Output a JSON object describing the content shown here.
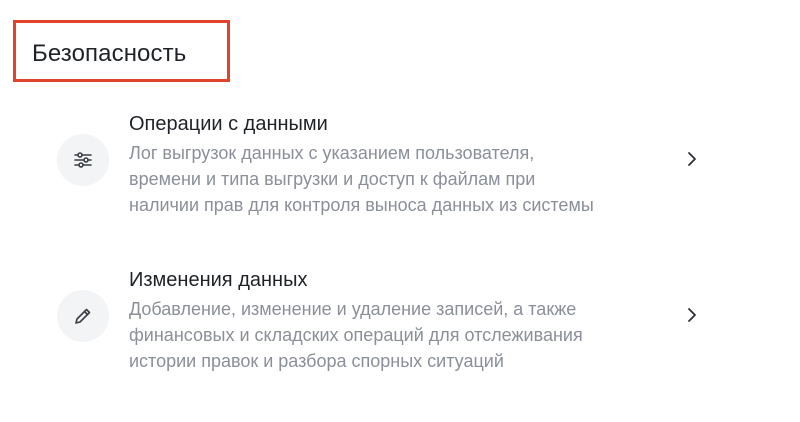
{
  "section": {
    "title": "Безопасность",
    "highlight_color": "#e0442b"
  },
  "items": [
    {
      "icon": "sliders-icon",
      "title": "Операции с данными",
      "description_lines": [
        "Лог выгрузок данных с указанием пользователя,",
        "времени и типа выгрузки и доступ к файлам при",
        "наличии прав для контроля выноса данных из системы"
      ]
    },
    {
      "icon": "pencil-icon",
      "title": "Изменения данных",
      "description_lines": [
        "Добавление, изменение и удаление записей, а также",
        "финансовых и складских операций для отслеживания",
        "истории правок и разбора спорных ситуаций"
      ]
    }
  ]
}
